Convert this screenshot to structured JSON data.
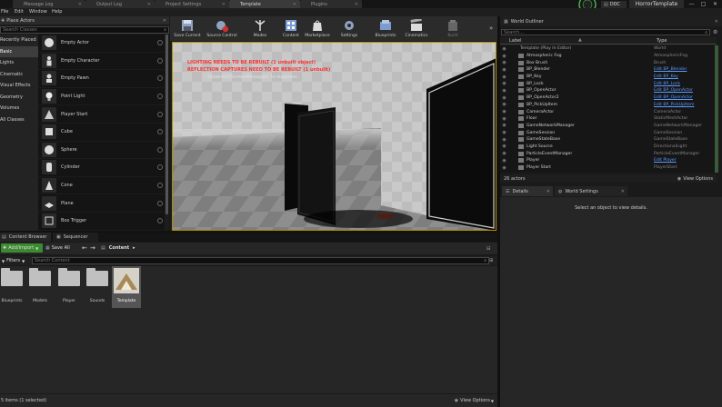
{
  "title_bar": {
    "tabs": [
      {
        "label": "Message Log"
      },
      {
        "label": "Output Log"
      },
      {
        "label": "Project Settings"
      },
      {
        "label": "Template"
      },
      {
        "label": "Plugins"
      }
    ],
    "ddc_label": "DDC",
    "project_name": "HorrorTemplate"
  },
  "menu": [
    "File",
    "Edit",
    "Window",
    "Help"
  ],
  "place_actors": {
    "title": "Place Actors",
    "search_placeholder": "Search Classes",
    "categories": [
      "Recently Placed",
      "Basic",
      "Lights",
      "Cinematic",
      "Visual Effects",
      "Geometry",
      "Volumes",
      "All Classes"
    ],
    "selected_category": 1,
    "items": [
      "Empty Actor",
      "Empty Character",
      "Empty Pawn",
      "Point Light",
      "Player Start",
      "Cube",
      "Sphere",
      "Cylinder",
      "Cone",
      "Plane",
      "Box Trigger"
    ]
  },
  "toolbar": {
    "buttons": [
      "Save Current",
      "Source Control",
      "Modes",
      "Content",
      "Marketplace",
      "Settings",
      "Blueprints",
      "Cinematics",
      "Build"
    ]
  },
  "viewport": {
    "warning_1": "LIGHTING NEEDS TO BE REBUILT (1 unbuilt object)",
    "warning_2": "REFLECTION CAPTURES NEED TO BE REBUILT (1 unbuilt)",
    "warning_3": "'DisableAllScreenMessages' to suppress"
  },
  "outliner": {
    "title": "World Outliner",
    "search_placeholder": "Search...",
    "col_label": "Label",
    "col_type": "Type",
    "rows": [
      {
        "label": "Template (Play In Editor)",
        "type": "World",
        "link": false
      },
      {
        "label": "Atmospheric Fog",
        "type": "AtmosphericFog",
        "link": false
      },
      {
        "label": "Box Brush",
        "type": "Brush",
        "link": false
      },
      {
        "label": "BP_Blender",
        "type": "Edit BP_Blender",
        "link": true
      },
      {
        "label": "BP_Key",
        "type": "Edit BP_Key",
        "link": true
      },
      {
        "label": "BP_Lock",
        "type": "Edit BP_Lock",
        "link": true
      },
      {
        "label": "BP_OpenActor",
        "type": "Edit BP_OpenActor",
        "link": true
      },
      {
        "label": "BP_OpenActor2",
        "type": "Edit BP_OpenActor",
        "link": true
      },
      {
        "label": "BP_PickUpItem",
        "type": "Edit BP_PickUpItem",
        "link": true
      },
      {
        "label": "CameraActor",
        "type": "CameraActor",
        "link": false
      },
      {
        "label": "Floor",
        "type": "StaticMeshActor",
        "link": false
      },
      {
        "label": "GameNetworkManager",
        "type": "GameNetworkManager",
        "link": false
      },
      {
        "label": "GameSession",
        "type": "GameSession",
        "link": false
      },
      {
        "label": "GameStateBase",
        "type": "GameStateBase",
        "link": false
      },
      {
        "label": "Light Source",
        "type": "DirectionalLight",
        "link": false
      },
      {
        "label": "ParticleEventManager",
        "type": "ParticleEventManager",
        "link": false
      },
      {
        "label": "Player",
        "type": "Edit Player",
        "link": true
      },
      {
        "label": "Player Start",
        "type": "PlayerStart",
        "link": false
      }
    ],
    "count": "26 actors",
    "view_options": "View Options"
  },
  "details": {
    "tab_details": "Details",
    "tab_world_settings": "World Settings",
    "empty_text": "Select an object to view details."
  },
  "content_browser": {
    "tab_label": "Content Browser",
    "tab_sequencer": "Sequencer",
    "add_import": "Add/Import",
    "save_all": "Save All",
    "path": "Content",
    "filters": "Filters",
    "search_placeholder": "Search Content",
    "folders": [
      "Blueprints",
      "Models",
      "Player",
      "Sounds",
      "Template"
    ],
    "status": "5 items (1 selected)",
    "view_options": "View Options"
  },
  "colors": {
    "accent_green": "#4caf50",
    "link_blue": "#5b9bff",
    "warning_red": "#ff3030",
    "selection": "#b38a00"
  }
}
